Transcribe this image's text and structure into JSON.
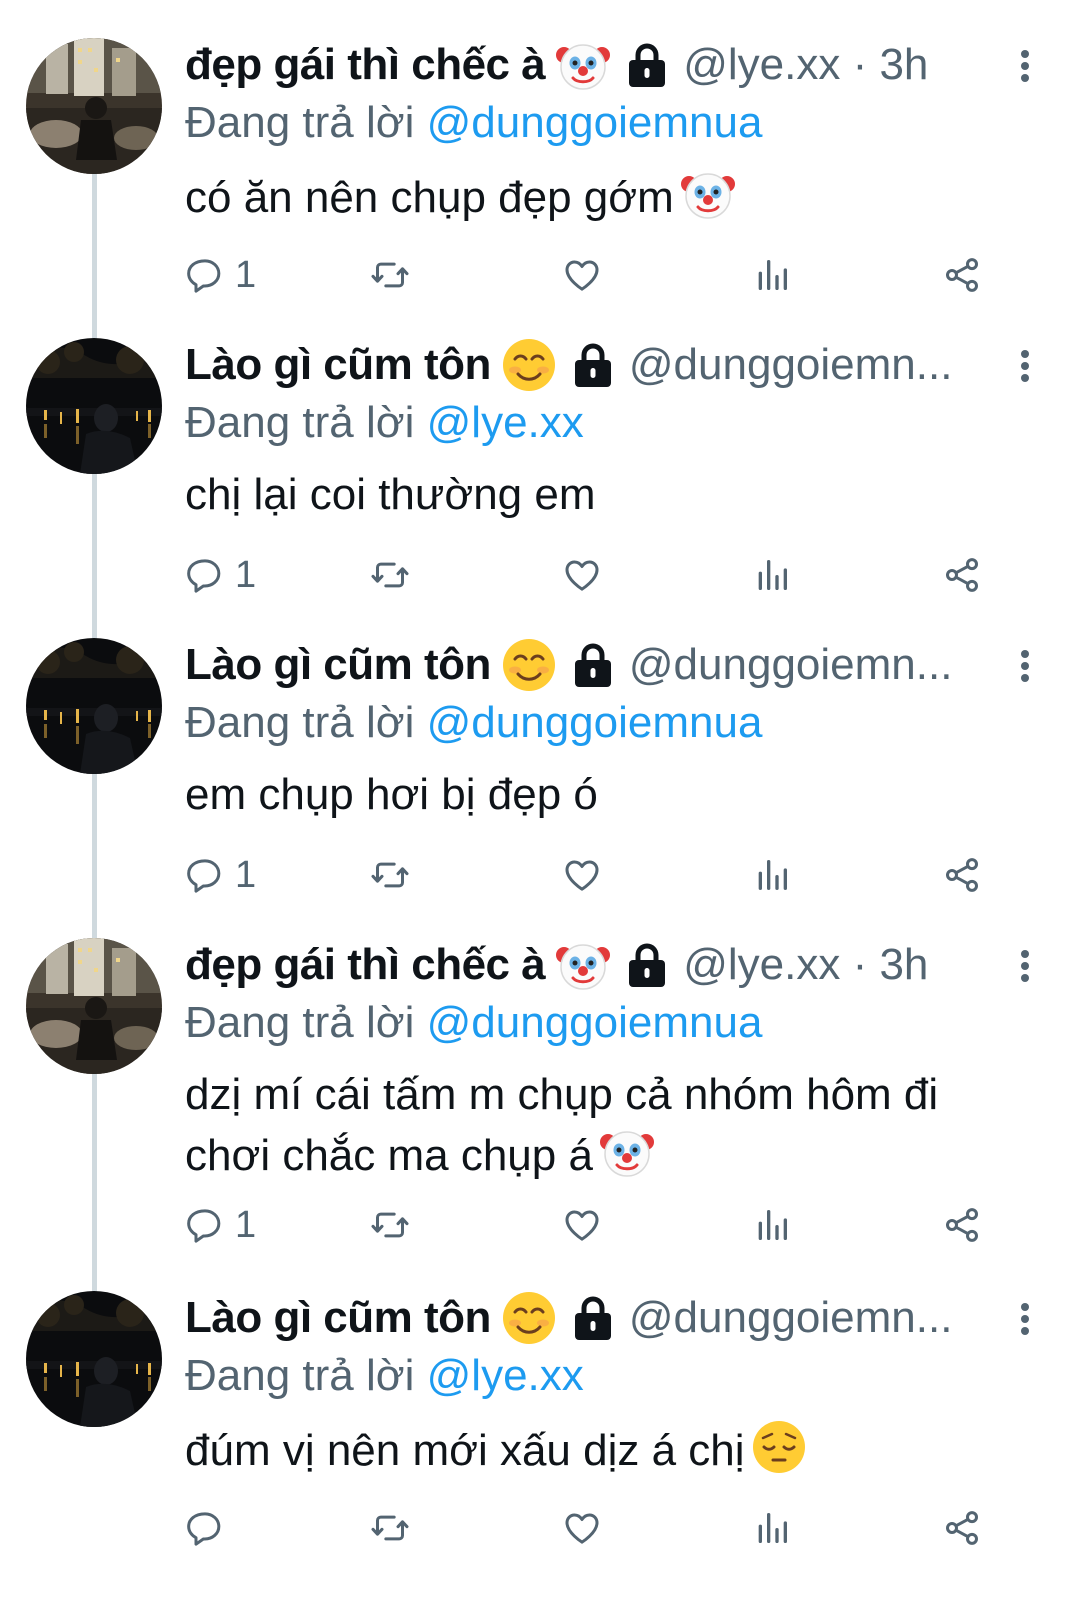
{
  "colors": {
    "text": "#0f1419",
    "secondary": "#536471",
    "mention": "#1d9bf0",
    "thread_line": "#cfd9de"
  },
  "icons": {
    "reply": "reply-icon",
    "retweet": "retweet-icon",
    "like": "heart-icon",
    "views": "views-icon",
    "share": "share-icon",
    "more": "more-vertical-icon",
    "lock": "lock-icon"
  },
  "tweets": [
    {
      "display_name": "đẹp gái thì chếc à",
      "name_emoji": "clown-emoji",
      "handle": "@lye.xx · 3h",
      "replying_prefix": "Đang trả lời",
      "replying_to": "@dunggoiemnua",
      "text_line1": "có ăn nên chụp đẹp gớm",
      "text_line2": "",
      "text_emoji": "clown-emoji",
      "reply_count": "1"
    },
    {
      "display_name": "Lào gì cũm tôn",
      "name_emoji": "smiling-emoji",
      "handle": "@dunggoiemn...",
      "replying_prefix": "Đang trả lời",
      "replying_to": "@lye.xx",
      "text_line1": "chị lại coi thường em",
      "text_line2": "",
      "text_emoji": "",
      "reply_count": "1"
    },
    {
      "display_name": "Lào gì cũm tôn",
      "name_emoji": "smiling-emoji",
      "handle": "@dunggoiemn...",
      "replying_prefix": "Đang trả lời",
      "replying_to": "@dunggoiemnua",
      "text_line1": "em chụp hơi bị đẹp ó",
      "text_line2": "",
      "text_emoji": "",
      "reply_count": "1"
    },
    {
      "display_name": "đẹp gái thì chếc à",
      "name_emoji": "clown-emoji",
      "handle": "@lye.xx · 3h",
      "replying_prefix": "Đang trả lời",
      "replying_to": "@dunggoiemnua",
      "text_line1": "dzị mí cái tấm m chụp cả nhóm hôm đi",
      "text_line2": "chơi chắc ma chụp á",
      "text_emoji": "clown-emoji",
      "reply_count": "1"
    },
    {
      "display_name": "Lào gì cũm tôn",
      "name_emoji": "smiling-emoji",
      "handle": "@dunggoiemn...",
      "replying_prefix": "Đang trả lời",
      "replying_to": "@lye.xx",
      "text_line1": "đúm vị nên mới xấu dịz á chị",
      "text_line2": "",
      "text_emoji": "pensive-emoji",
      "reply_count": ""
    }
  ]
}
